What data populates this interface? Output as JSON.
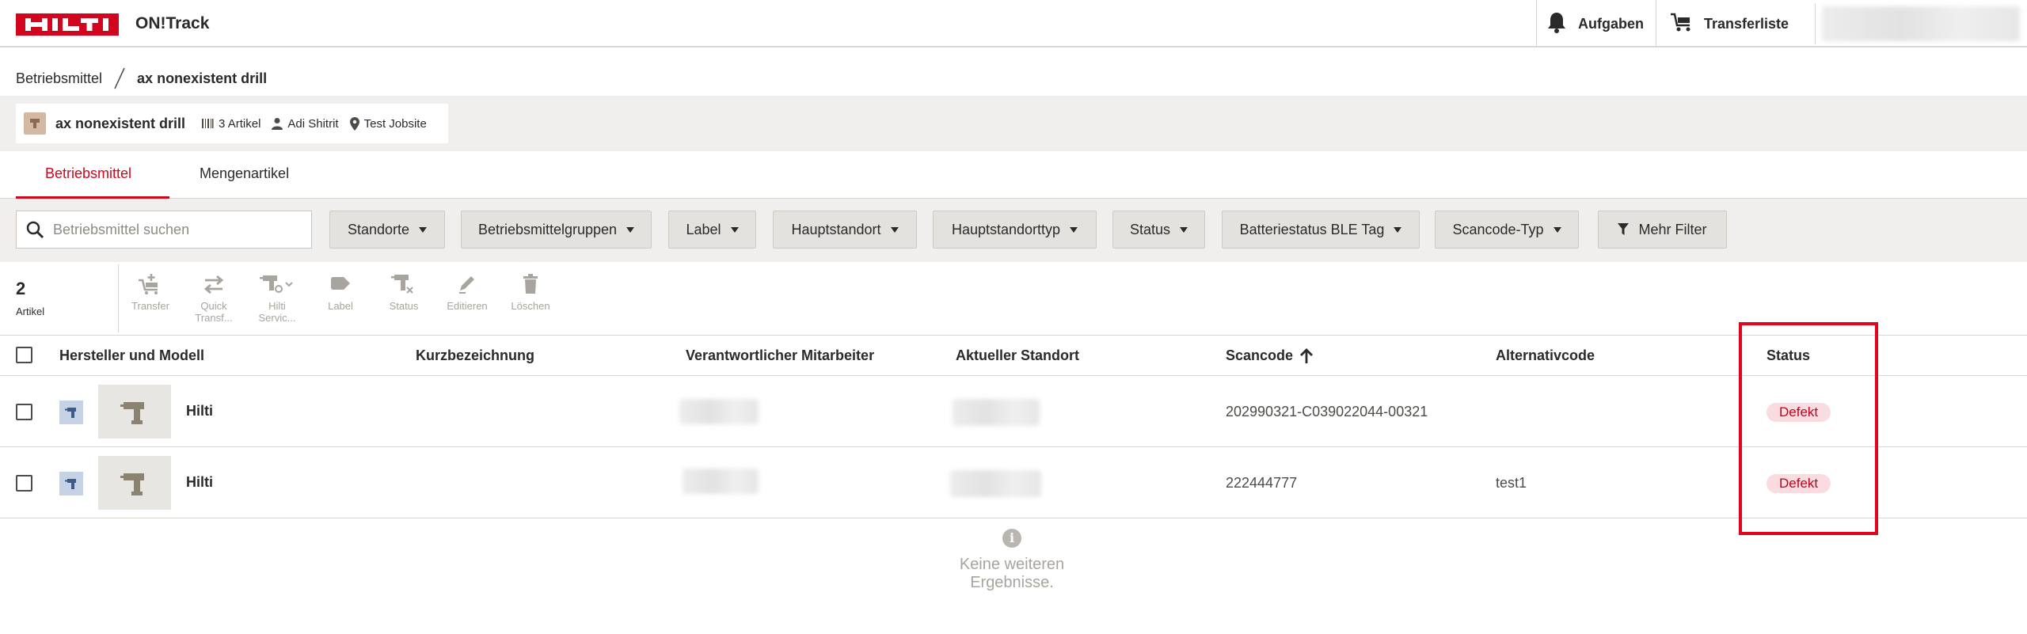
{
  "header": {
    "logo_text": "HILTI",
    "app_title": "ON!Track",
    "tasks_label": "Aufgaben",
    "transfer_label": "Transferliste",
    "icons": {
      "tasks": "bell-icon",
      "transfer": "cart-icon"
    }
  },
  "breadcrumb": {
    "root": "Betriebsmittel",
    "current": "ax nonexistent drill"
  },
  "asset_info": {
    "name": "ax nonexistent drill",
    "article_count": "3 Artikel",
    "employee": "Adi Shitrit",
    "location": "Test Jobsite"
  },
  "tabs": [
    {
      "label": "Betriebsmittel",
      "active": true
    },
    {
      "label": "Mengenartikel",
      "active": false
    }
  ],
  "search": {
    "placeholder": "Betriebsmittel suchen",
    "value": ""
  },
  "filters": [
    {
      "label": "Standorte"
    },
    {
      "label": "Betriebsmittelgruppen"
    },
    {
      "label": "Label"
    },
    {
      "label": "Hauptstandort"
    },
    {
      "label": "Hauptstandorttyp"
    },
    {
      "label": "Status"
    },
    {
      "label": "Batteriestatus BLE Tag"
    },
    {
      "label": "Scancode-Typ"
    },
    {
      "label": "Mehr Filter"
    }
  ],
  "results": {
    "count": "2",
    "label": "Artikel"
  },
  "toolbar": [
    {
      "label": "Transfer",
      "icon": "cart-add-icon"
    },
    {
      "label": "Quick Transf...",
      "icon": "swap-arrows-icon"
    },
    {
      "label": "Hilti Servic...",
      "icon": "drill-service-icon"
    },
    {
      "label": "Label",
      "icon": "tag-icon"
    },
    {
      "label": "Status",
      "icon": "drill-status-icon"
    },
    {
      "label": "Editieren",
      "icon": "pencil-icon"
    },
    {
      "label": "Löschen",
      "icon": "trash-icon"
    }
  ],
  "table": {
    "columns": [
      "Hersteller und Modell",
      "Kurzbezeichnung",
      "Verantwortlicher Mitarbeiter",
      "Aktueller Standort",
      "Scancode",
      "Alternativcode",
      "Status"
    ],
    "rows": [
      {
        "manufacturer": "Hilti",
        "short_name": "",
        "scancode": "202990321-C039022044-00321",
        "alt_code": "",
        "status": "Defekt"
      },
      {
        "manufacturer": "Hilti",
        "short_name": "",
        "scancode": "222444777",
        "alt_code": "test1",
        "status": "Defekt"
      }
    ]
  },
  "footer_message": "Keine weiteren Ergebnisse.",
  "colors": {
    "brand_red": "#d2051e",
    "status_badge_bg": "#fadce0",
    "status_badge_text": "#c0021b",
    "highlight": "#e3051b"
  }
}
